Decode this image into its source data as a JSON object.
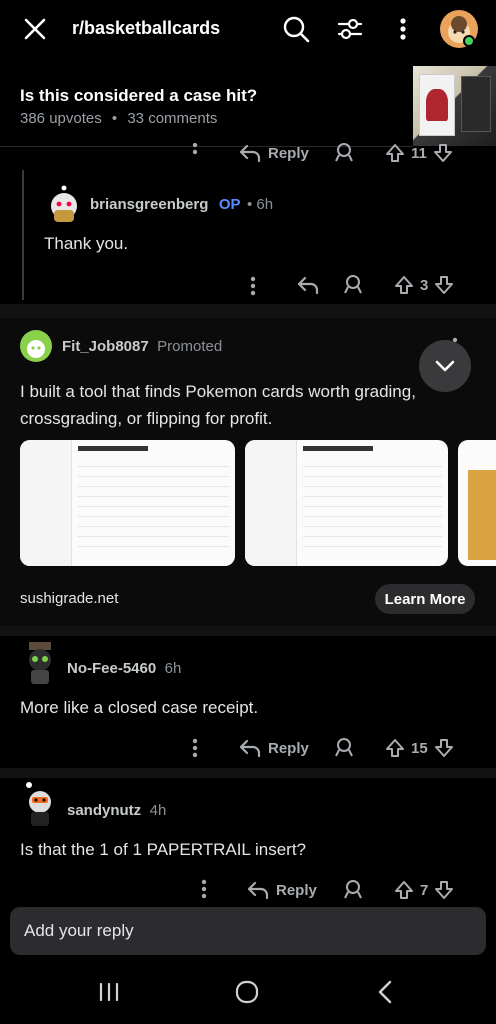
{
  "header": {
    "title": "r/basketballcards",
    "icons": [
      "close-icon",
      "search-icon",
      "filter-icon",
      "more-vertical-icon",
      "avatar"
    ]
  },
  "post": {
    "title": "Is this considered a case hit?",
    "upvotes": "386 upvotes",
    "dot": "•",
    "comments": "33 comments"
  },
  "top_comment_actions": {
    "reply": "Reply",
    "votes": "11"
  },
  "comment_op": {
    "username": "briansgreenberg",
    "op_badge": "OP",
    "time": "• 6h",
    "text": "Thank you.",
    "votes": "3"
  },
  "promoted": {
    "username": "Fit_Job8087",
    "label": "Promoted",
    "text": "I built a tool that finds Pokemon cards worth grading, crossgrading, or flipping for profit.",
    "domain": "sushigrade.net",
    "cta": "Learn More"
  },
  "comment_nofee": {
    "username": "No-Fee-5460",
    "time": "6h",
    "text": "More like a closed case receipt.",
    "reply": "Reply",
    "votes": "15"
  },
  "comment_sandy": {
    "username": "sandynutz",
    "time": "4h",
    "text": "Is that the 1 of 1 PAPERTRAIL insert?",
    "reply": "Reply",
    "votes": "7"
  },
  "reply_box": {
    "placeholder": "Add your reply"
  },
  "colors": {
    "background": "#000000",
    "op_blue": "#5b8cff",
    "online_green": "#46d160"
  }
}
